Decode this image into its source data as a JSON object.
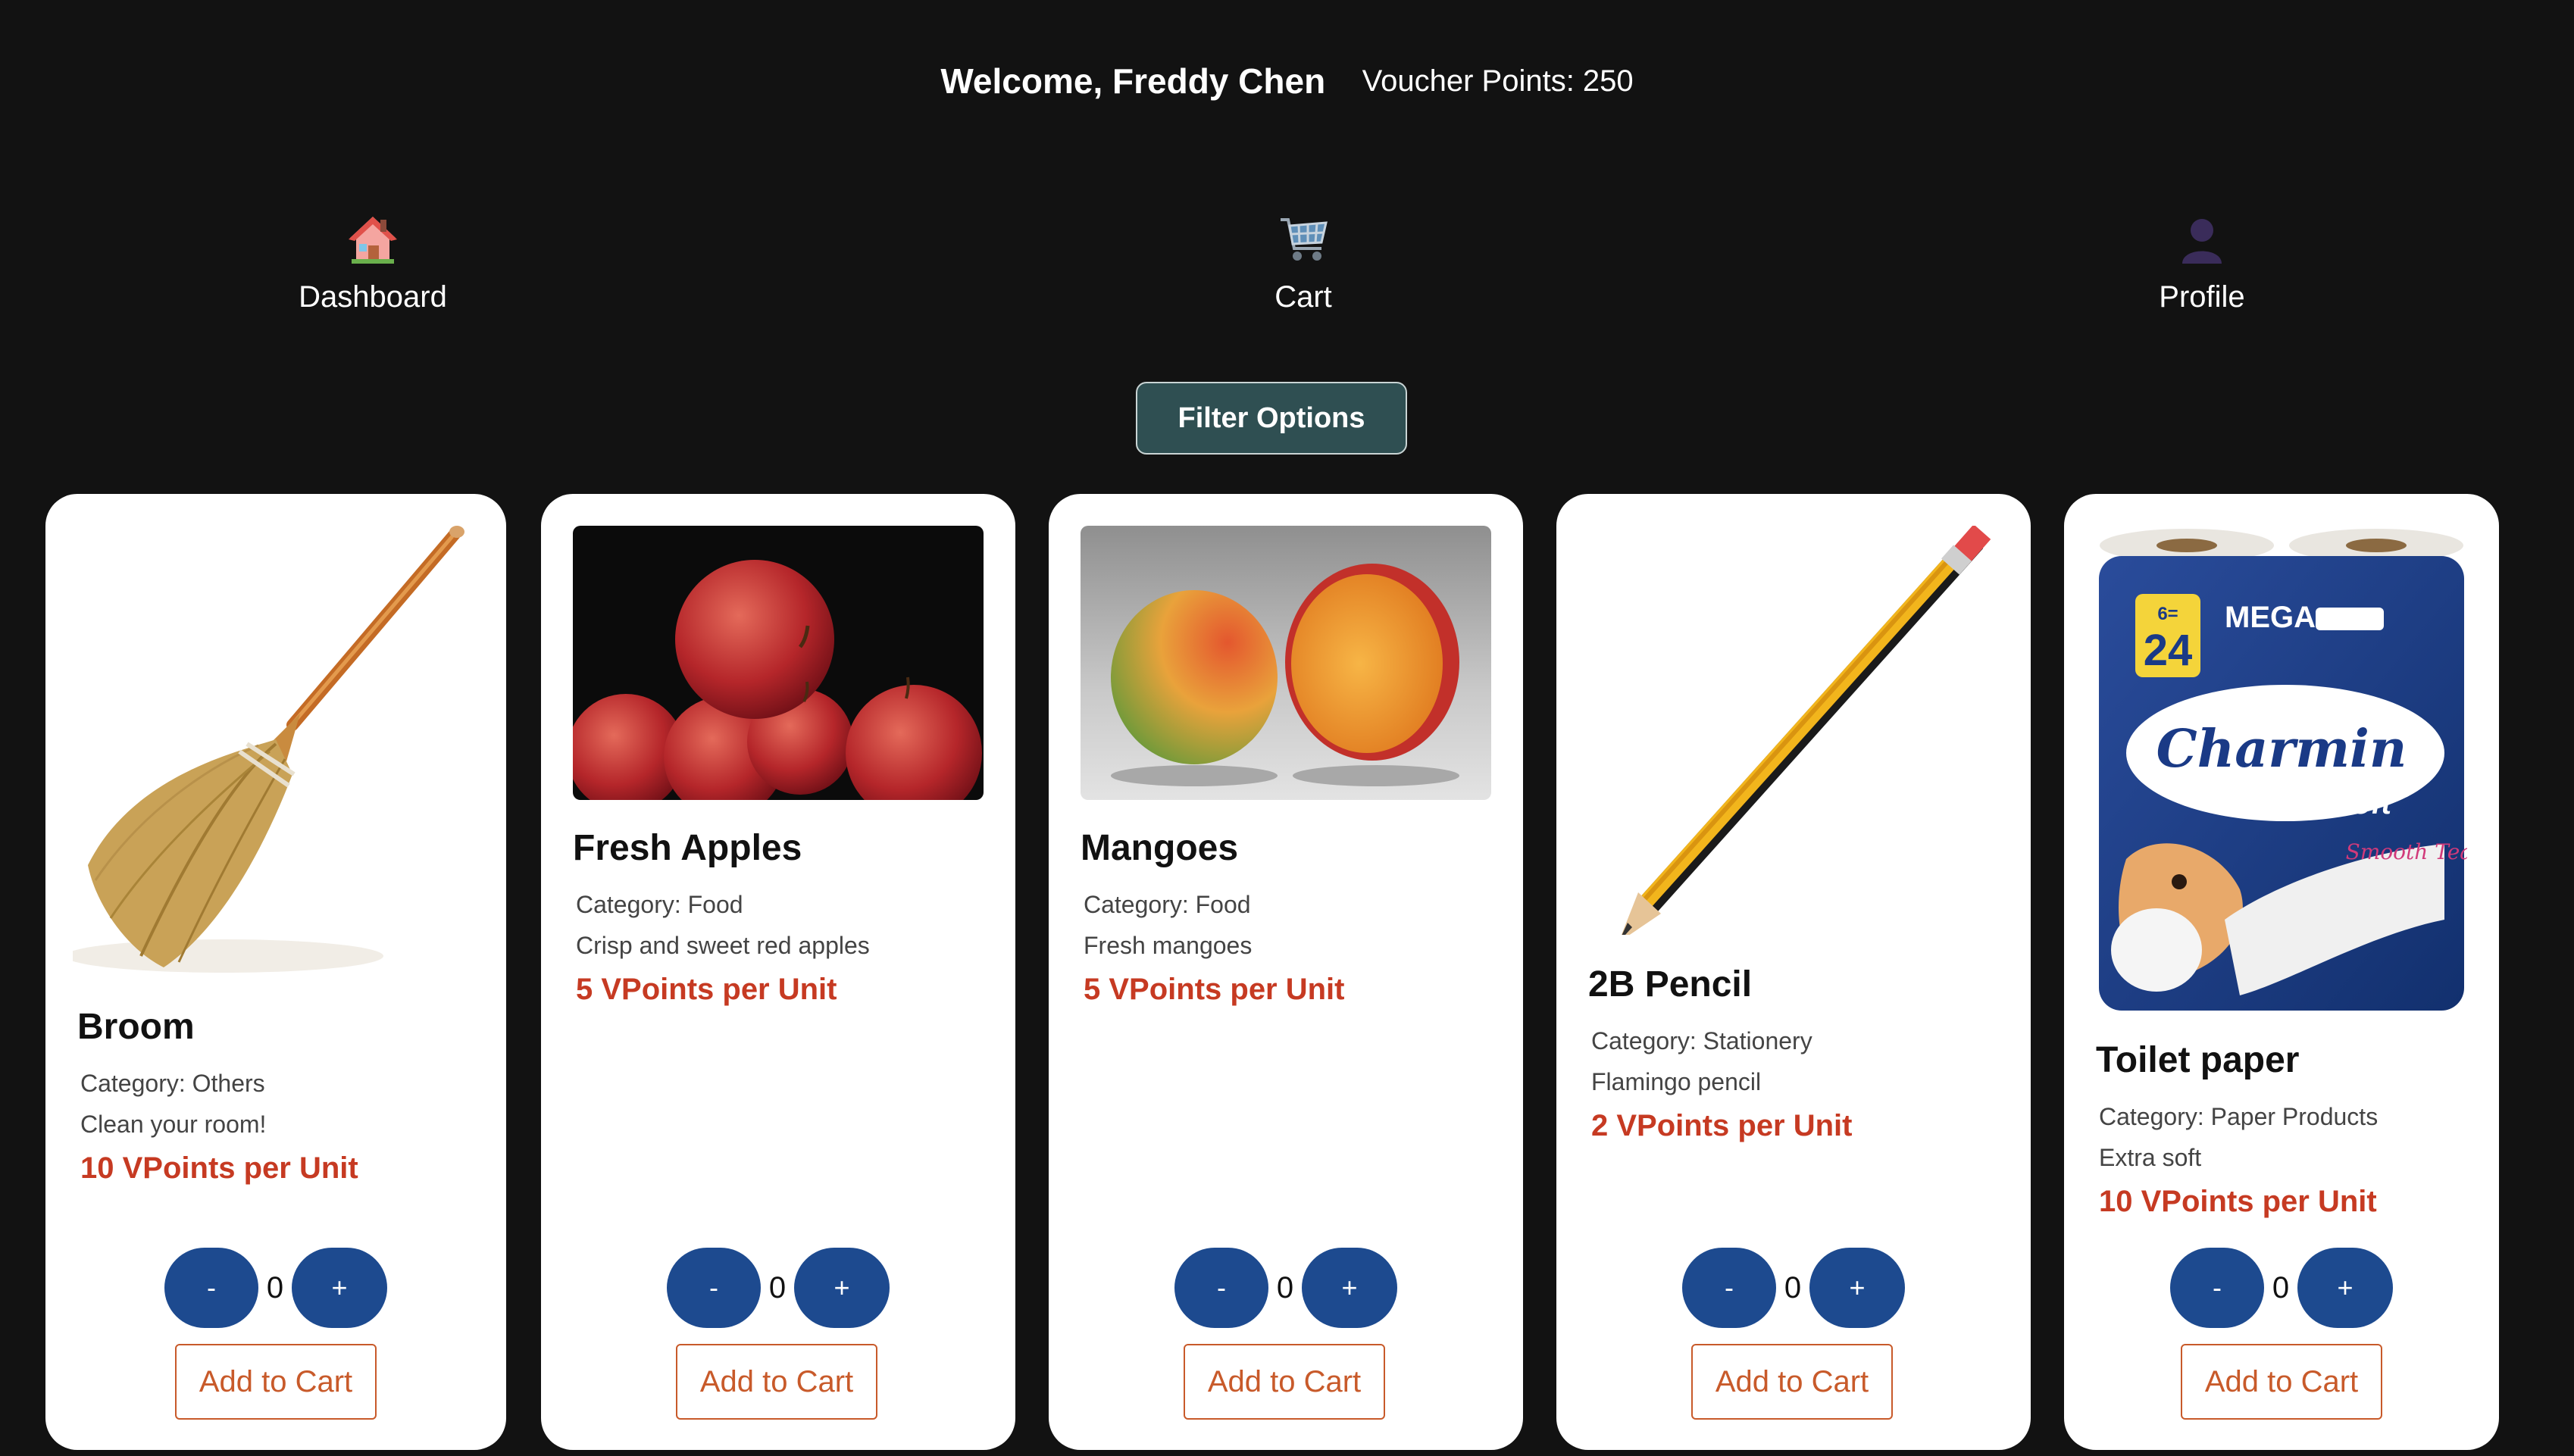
{
  "header": {
    "welcome": "Welcome, Freddy Chen",
    "points": "Voucher Points: 250"
  },
  "nav": [
    {
      "label": "Dashboard",
      "icon": "house-icon"
    },
    {
      "label": "Cart",
      "icon": "shopping-cart-icon"
    },
    {
      "label": "Profile",
      "icon": "person-silhouette-icon"
    }
  ],
  "filter": {
    "label": "Filter Options"
  },
  "products": [
    {
      "name": "Broom",
      "category": "Category: Others",
      "description": "Clean your room!",
      "price": "10 VPoints per Unit",
      "quantity": "0",
      "minus": "-",
      "plus": "+",
      "add_label": "Add to Cart",
      "image": "broom-image"
    },
    {
      "name": "Fresh Apples",
      "category": "Category: Food",
      "description": "Crisp and sweet red apples",
      "price": "5 VPoints per Unit",
      "quantity": "0",
      "minus": "-",
      "plus": "+",
      "add_label": "Add to Cart",
      "image": "apples-image"
    },
    {
      "name": "Mangoes",
      "category": "Category: Food",
      "description": "Fresh mangoes",
      "price": "5 VPoints per Unit",
      "quantity": "0",
      "minus": "-",
      "plus": "+",
      "add_label": "Add to Cart",
      "image": "mangoes-image"
    },
    {
      "name": "2B Pencil",
      "category": "Category: Stationery",
      "description": "Flamingo pencil",
      "price": "2 VPoints per Unit",
      "quantity": "0",
      "minus": "-",
      "plus": "+",
      "add_label": "Add to Cart",
      "image": "pencil-image"
    },
    {
      "name": "Toilet paper",
      "category": "Category: Paper Products",
      "description": "Extra soft",
      "price": "10 VPoints per Unit",
      "quantity": "0",
      "minus": "-",
      "plus": "+",
      "add_label": "Add to Cart",
      "image": "toilet-paper-image"
    }
  ],
  "package_text": {
    "count": "6=",
    "count_big": "24",
    "size": "MEGA",
    "brand": "Charmin",
    "line": "Ultra Soft",
    "tag": "Smooth Tear"
  },
  "colors": {
    "background": "#121212",
    "card": "#ffffff",
    "price": "#c63a22",
    "qty_button": "#1d4a8f",
    "cart_button_accent": "#c85a2a",
    "filter_button": "#2f4f52"
  }
}
